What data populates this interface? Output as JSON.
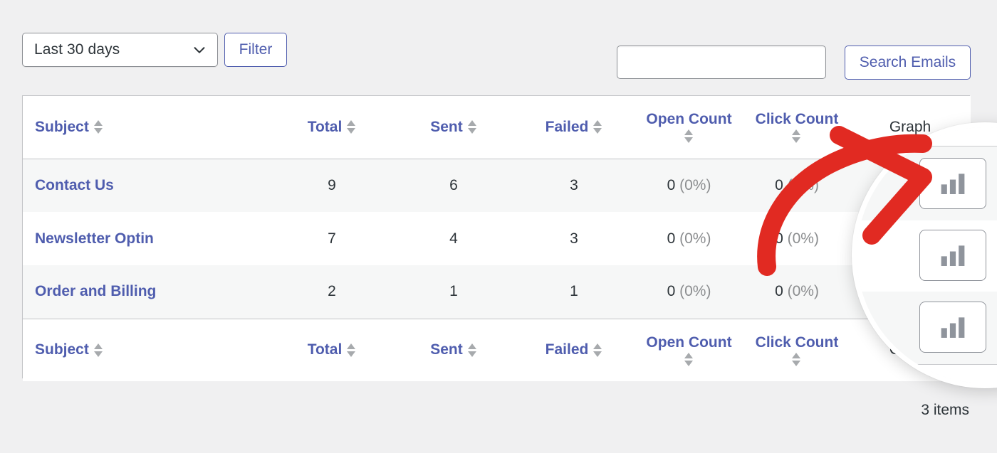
{
  "toolbar": {
    "date_range_value": "Last 30 days",
    "date_range_icon": "chevron-down-icon",
    "filter_label": "Filter",
    "search_value": "",
    "search_placeholder": "",
    "search_button_label": "Search Emails"
  },
  "table": {
    "columns": [
      {
        "key": "subject",
        "label": "Subject",
        "sortable": true
      },
      {
        "key": "total",
        "label": "Total",
        "sortable": true
      },
      {
        "key": "sent",
        "label": "Sent",
        "sortable": true
      },
      {
        "key": "failed",
        "label": "Failed",
        "sortable": true
      },
      {
        "key": "open_count",
        "label": "Open Count",
        "sortable": true
      },
      {
        "key": "click_count",
        "label": "Click Count",
        "sortable": true
      },
      {
        "key": "graph",
        "label": "Graph",
        "sortable": false
      }
    ],
    "rows": [
      {
        "subject": "Contact Us",
        "total": "9",
        "sent": "6",
        "failed": "3",
        "open_count": "0",
        "open_pct": "(0%)",
        "click_count": "0",
        "click_pct": "(0%)",
        "graph_icon": "bar-chart-icon"
      },
      {
        "subject": "Newsletter Optin",
        "total": "7",
        "sent": "4",
        "failed": "3",
        "open_count": "0",
        "open_pct": "(0%)",
        "click_count": "0",
        "click_pct": "(0%)",
        "graph_icon": "bar-chart-icon"
      },
      {
        "subject": "Order and Billing",
        "total": "2",
        "sent": "1",
        "failed": "1",
        "open_count": "0",
        "open_pct": "(0%)",
        "click_count": "0",
        "click_pct": "(0%)",
        "graph_icon": "bar-chart-icon"
      }
    ]
  },
  "footer": {
    "items_count": "3 items"
  },
  "annotation": {
    "arrow_color": "#e12a22",
    "arrow_target": "graph-button-row-1",
    "magnifier_focus": "graph-column-buttons"
  },
  "colors": {
    "link": "#4f5dae",
    "text": "#2c3338",
    "muted": "#8b8d8f",
    "page_bg": "#f0f0f1",
    "row_alt_bg": "#f6f7f7",
    "border": "#c3c4c7",
    "accent_border": "#4f5dae",
    "sort_arrow": "#a7aaad"
  }
}
